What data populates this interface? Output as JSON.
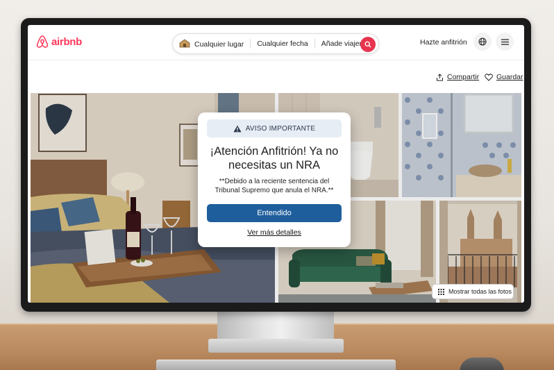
{
  "brand": {
    "name": "airbnb",
    "color": "#ff385c"
  },
  "search": {
    "place": "Cualquier lugar",
    "date": "Cualquier fecha",
    "guests": "Añade viajeros",
    "button_icon": "search-icon"
  },
  "header": {
    "host_label": "Hazte anfitrión",
    "globe_icon": "globe-icon",
    "menu_icon": "menu-icon"
  },
  "listing_actions": {
    "share_label": "Compartir",
    "save_label": "Guardar"
  },
  "gallery": {
    "photos": [
      "bedroom-with-wine",
      "bathroom-toilet",
      "bathroom-shower-and-sink",
      "living-room-green-sofa",
      "balcony-view-of-church"
    ],
    "show_all_label": "Mostrar todas las fotos"
  },
  "modal": {
    "tag_label": "AVISO IMPORTANTE",
    "tag_icon": "warning-icon",
    "title": "¡Atención Anfitrión! Ya no necesitas un NRA",
    "body": "**Debido a la reciente sentencia del Tribunal Supremo que anula el NRA.**",
    "primary_label": "Entendido",
    "link_label": "Ver más detalles",
    "primary_color": "#1f5e9c"
  }
}
